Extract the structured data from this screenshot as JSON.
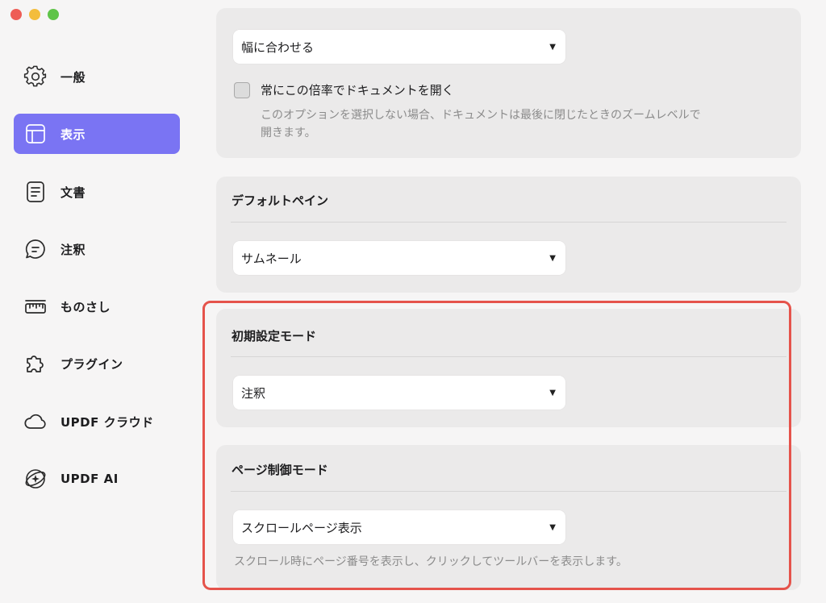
{
  "window": {
    "controls": [
      "close",
      "minimize",
      "zoom"
    ],
    "colors": {
      "close": "#ee5d56",
      "minimize": "#f3bd3c",
      "zoom": "#5fc448"
    }
  },
  "sidebar": {
    "active_color": "#7a74f3",
    "items": [
      {
        "label": "一般",
        "icon": "gear-icon",
        "active": false
      },
      {
        "label": "表示",
        "icon": "layout-icon",
        "active": true
      },
      {
        "label": "文書",
        "icon": "document-icon",
        "active": false
      },
      {
        "label": "注釈",
        "icon": "comment-icon",
        "active": false
      },
      {
        "label": "ものさし",
        "icon": "ruler-icon",
        "active": false
      },
      {
        "label": "プラグイン",
        "icon": "puzzle-icon",
        "active": false
      },
      {
        "label": "UPDF クラウド",
        "icon": "cloud-icon",
        "active": false
      },
      {
        "label": "UPDF AI",
        "icon": "ai-icon",
        "active": false
      }
    ]
  },
  "zoom_section": {
    "select_value": "幅に合わせる",
    "checkbox_label": "常にこの倍率でドキュメントを開く",
    "checkbox_checked": false,
    "description_line1": "このオプションを選択しない場合、ドキュメントは最後に閉じたときのズームレベルで",
    "description_line2": "開きます。"
  },
  "default_pane": {
    "title": "デフォルトペイン",
    "select_value": "サムネール"
  },
  "initial_mode": {
    "title": "初期設定モード",
    "select_value": "注釈"
  },
  "page_control_mode": {
    "title": "ページ制御モード",
    "select_value": "スクロールページ表示",
    "description": "スクロール時にページ番号を表示し、クリックしてツールバーを表示します。"
  },
  "highlight_color": "#e5534b"
}
